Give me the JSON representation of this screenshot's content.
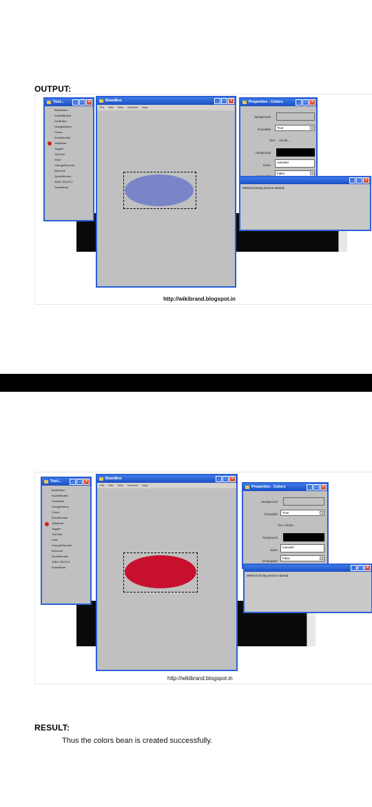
{
  "document": {
    "output_heading": "OUTPUT:",
    "result_heading": "RESULT:",
    "result_text": "Thus the colors bean is created successfully."
  },
  "figures": [
    {
      "url_caption": "http://wikibrand.blogspot.in",
      "ellipse_color": "#7a85c9",
      "toolbox": {
        "title": "Tool...",
        "items": [
          "BlueButton",
          "ExplicitButton",
          "OurButton",
          "OrangeButton",
          "Colors",
          "EventMonitor",
          "JellyBean",
          "Juggler",
          "TickTock",
          "Voter",
          "ChangeReporter",
          "Molecule",
          "QuoteMonitor",
          "JDBC SELECT",
          "SorterBean"
        ]
      },
      "beanbox": {
        "title": "BeanBox",
        "menu": [
          "File",
          "Edit",
          "View",
          "Services",
          "Help"
        ]
      },
      "properties": {
        "title": "Properties - Colors",
        "rows": [
          "background",
          "focusable",
          "font",
          "foreground",
          "name",
          "rectangular"
        ],
        "focusable_value": "True",
        "font_value": "Abcde...",
        "name_value": "canvas0",
        "rectangular_value": "False"
      },
      "log": {
        "text": "Method tracing service started."
      }
    },
    {
      "url_caption": "http://wikibrand.blogspot.in",
      "ellipse_color": "#c8102e",
      "toolbox": {
        "title": "Tool...",
        "items": [
          "BlueButton",
          "ExplicitButton",
          "OurButton",
          "OrangeButton",
          "Colors",
          "EventMonitor",
          "JellyBean",
          "Juggler",
          "TickTock",
          "Voter",
          "ChangeReporter",
          "Molecule",
          "QuoteMonitor",
          "JDBC SELECT",
          "SorterBean"
        ]
      },
      "beanbox": {
        "title": "BeanBox",
        "menu": [
          "File",
          "Edit",
          "View",
          "Services",
          "Help"
        ]
      },
      "properties": {
        "title": "Properties - Colors",
        "rows": [
          "background",
          "focusable",
          "font",
          "foreground",
          "name",
          "rectangular"
        ],
        "focusable_value": "True",
        "font_value": "Abcde...",
        "name_value": "canvas0",
        "rectangular_value": "False"
      },
      "log": {
        "text": "Method tracing service started."
      }
    }
  ],
  "divider_color": "#000000"
}
